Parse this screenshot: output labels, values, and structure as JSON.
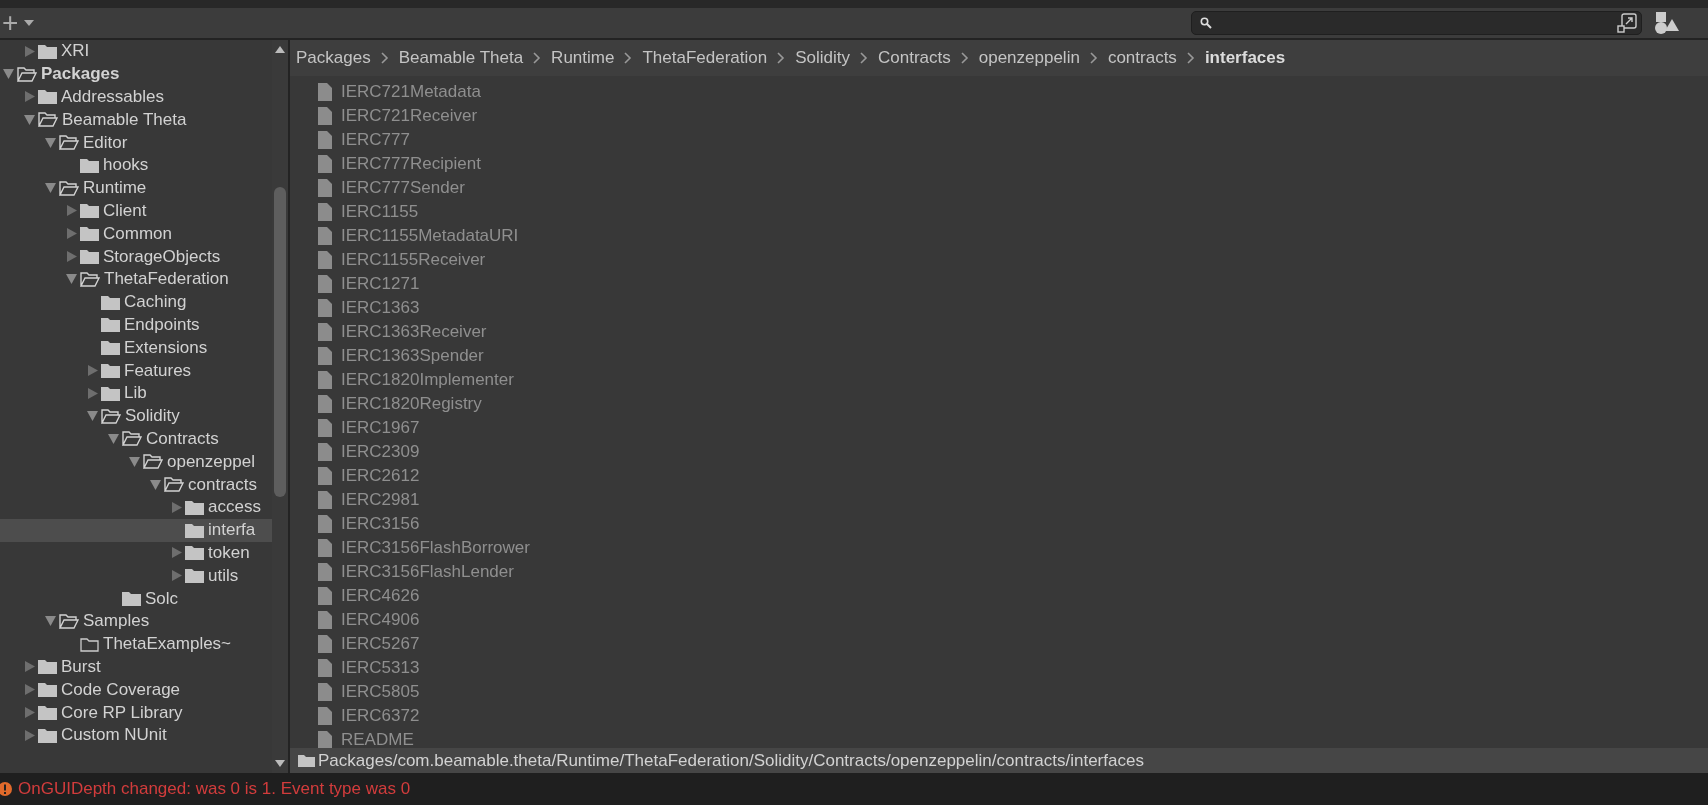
{
  "toolbar": {
    "add_label": "+"
  },
  "tree": [
    {
      "children": [
        {
          "name": "XRI",
          "expanded": false,
          "selected": false
        }
      ]
    },
    {
      "name": "Packages",
      "expanded": true,
      "selected": false,
      "bold": true,
      "children": [
        {
          "name": "Addressables",
          "expanded": false,
          "selected": false
        },
        {
          "name": "Beamable Theta",
          "expanded": true,
          "selected": false,
          "children": [
            {
              "name": "Editor",
              "expanded": true,
              "selected": false,
              "children": [
                {
                  "name": "hooks",
                  "selected": false
                }
              ]
            },
            {
              "name": "Runtime",
              "expanded": true,
              "selected": false,
              "children": [
                {
                  "name": "Client",
                  "expanded": false,
                  "selected": false
                },
                {
                  "name": "Common",
                  "expanded": false,
                  "selected": false
                },
                {
                  "name": "StorageObjects",
                  "expanded": false,
                  "selected": false
                },
                {
                  "name": "ThetaFederation",
                  "expanded": true,
                  "selected": false,
                  "children": [
                    {
                      "name": "Caching",
                      "selected": false
                    },
                    {
                      "name": "Endpoints",
                      "selected": false
                    },
                    {
                      "name": "Extensions",
                      "selected": false
                    },
                    {
                      "name": "Features",
                      "expanded": false,
                      "selected": false
                    },
                    {
                      "name": "Lib",
                      "expanded": false,
                      "selected": false
                    },
                    {
                      "name": "Solidity",
                      "expanded": true,
                      "selected": false,
                      "children": [
                        {
                          "name": "Contracts",
                          "expanded": true,
                          "selected": false,
                          "children": [
                            {
                              "name": "openzeppel",
                              "expanded": true,
                              "selected": false,
                              "children": [
                                {
                                  "name": "contracts",
                                  "expanded": true,
                                  "selected": false,
                                  "children": [
                                    {
                                      "name": "access",
                                      "expanded": false,
                                      "selected": false
                                    },
                                    {
                                      "name": "interfa",
                                      "selected": true
                                    },
                                    {
                                      "name": "token",
                                      "expanded": false,
                                      "selected": false
                                    },
                                    {
                                      "name": "utils",
                                      "expanded": false,
                                      "selected": false
                                    }
                                  ]
                                }
                              ]
                            }
                          ]
                        },
                        {
                          "name": "Solc",
                          "selected": false
                        }
                      ]
                    }
                  ]
                }
              ]
            },
            {
              "name": "Samples",
              "expanded": true,
              "selected": false,
              "children": [
                {
                  "name": "ThetaExamples~",
                  "selected": false,
                  "empty": true
                }
              ]
            }
          ]
        },
        {
          "name": "Burst",
          "expanded": false,
          "selected": false
        },
        {
          "name": "Code Coverage",
          "expanded": false,
          "selected": false
        },
        {
          "name": "Core RP Library",
          "expanded": false,
          "selected": false
        },
        {
          "name": "Custom NUnit",
          "expanded": false,
          "selected": false
        }
      ]
    }
  ],
  "breadcrumb": [
    {
      "label": "Packages",
      "selected": false
    },
    {
      "label": "Beamable Theta",
      "selected": false
    },
    {
      "label": "Runtime",
      "selected": false
    },
    {
      "label": "ThetaFederation",
      "selected": false
    },
    {
      "label": "Solidity",
      "selected": false
    },
    {
      "label": "Contracts",
      "selected": false
    },
    {
      "label": "openzeppelin",
      "selected": false
    },
    {
      "label": "contracts",
      "selected": false
    },
    {
      "label": "interfaces",
      "selected": true
    }
  ],
  "files": [
    "IERC721Metadata",
    "IERC721Receiver",
    "IERC777",
    "IERC777Recipient",
    "IERC777Sender",
    "IERC1155",
    "IERC1155MetadataURI",
    "IERC1155Receiver",
    "IERC1271",
    "IERC1363",
    "IERC1363Receiver",
    "IERC1363Spender",
    "IERC1820Implementer",
    "IERC1820Registry",
    "IERC1967",
    "IERC2309",
    "IERC2612",
    "IERC2981",
    "IERC3156",
    "IERC3156FlashBorrower",
    "IERC3156FlashLender",
    "IERC4626",
    "IERC4906",
    "IERC5267",
    "IERC5313",
    "IERC5805",
    "IERC6372",
    "README"
  ],
  "path_bar": "Packages/com.beamable.theta/Runtime/ThetaFederation/Solidity/Contracts/openzeppelin/contracts/interfaces",
  "status_bar": {
    "kind": "error",
    "message": "OnGUIDepth changed: was 0 is 1. Event type was 0"
  }
}
